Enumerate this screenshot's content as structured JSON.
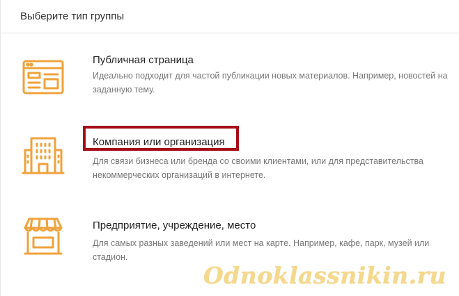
{
  "header": {
    "title": "Выберите тип группы"
  },
  "options": [
    {
      "icon": "web-page-icon",
      "title": "Публичная страница",
      "description": "Идеально подходит для частой публикации новых материалов. Например, новостей на заданную тему."
    },
    {
      "icon": "office-building-icon",
      "title": "Компания или организация",
      "description": "Для связи бизнеса или бренда со своими клиентами, или для представительства некоммерческих организаций в интернете."
    },
    {
      "icon": "storefront-icon",
      "title": "Предприятие, учреждение, место",
      "description": "Для самых разных заведений или мест на карте. Например, кафе, парк, музей или стадион."
    }
  ],
  "watermark": "Odnoklassnikin.ru",
  "colors": {
    "icon": "#f0a23b",
    "highlight": "#a50e19",
    "watermark": "#f3d27a"
  }
}
